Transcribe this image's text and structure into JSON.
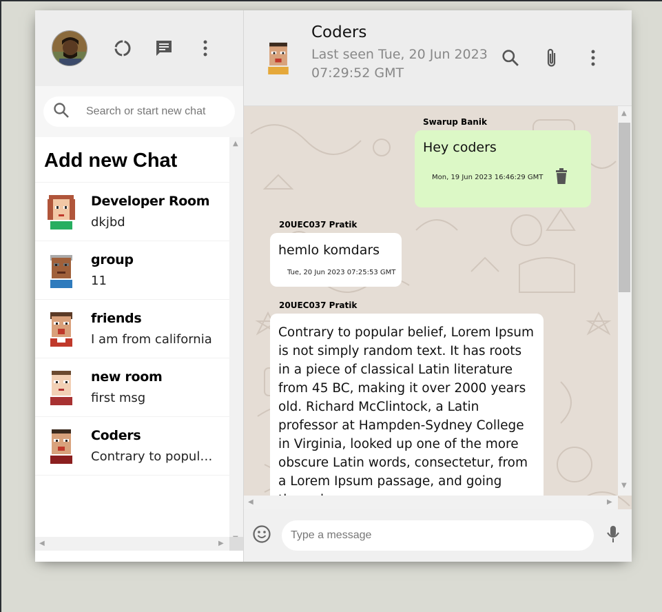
{
  "colors": {
    "outgoing_bubble": "#dcf8c6",
    "incoming_bubble": "#ffffff",
    "chat_wallpaper": "#e5ddd5",
    "header_bg": "#ededed"
  },
  "sidebar": {
    "header_icons": [
      "refresh-icon",
      "message-icon",
      "more-vert-icon"
    ],
    "search": {
      "placeholder": "Search or start new chat"
    },
    "add_chat_label": "Add new Chat",
    "chats": [
      {
        "name": "Developer Room",
        "last": "dkjbd"
      },
      {
        "name": "group",
        "last": "11"
      },
      {
        "name": "friends",
        "last": "I am from california"
      },
      {
        "name": "new room",
        "last": "first msg"
      },
      {
        "name": "Coders",
        "last": "Contrary to popular belief, Lorem Ipsum"
      }
    ]
  },
  "chat": {
    "name": "Coders",
    "last_seen": "Last seen Tue, 20 Jun 2023 07:29:52 GMT",
    "header_icons": [
      "search-icon",
      "attach-icon",
      "more-vert-icon"
    ],
    "messages": [
      {
        "sender": "Swarup Banik",
        "text": "Hey coders",
        "time": "Mon, 19 Jun 2023 16:46:29 GMT",
        "outgoing": true
      },
      {
        "sender": "20UEC037 Pratik",
        "text": "hemlo komdars",
        "time": "Tue, 20 Jun 2023 07:25:53 GMT",
        "outgoing": false
      },
      {
        "sender": "20UEC037 Pratik",
        "text": "Contrary to popular belief, Lorem Ipsum is not simply random text. It has roots in a piece of classical Latin literature from 45 BC, making it over 2000 years old. Richard McClintock, a Latin professor at Hampden-Sydney College in Virginia, looked up one of the more obscure Latin words, consectetur, from a Lorem Ipsum passage, and going through",
        "time": "",
        "outgoing": false
      }
    ],
    "input": {
      "placeholder": "Type a message"
    }
  }
}
